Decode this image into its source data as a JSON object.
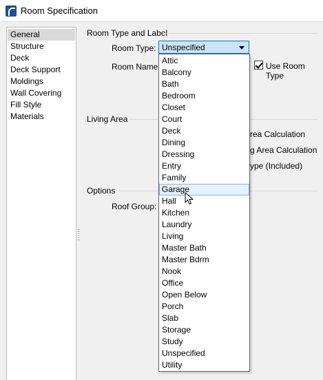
{
  "window": {
    "title": "Room Specification"
  },
  "sidebar": {
    "items": [
      {
        "label": "General",
        "selected": true
      },
      {
        "label": "Structure"
      },
      {
        "label": "Deck"
      },
      {
        "label": "Deck Support"
      },
      {
        "label": "Moldings"
      },
      {
        "label": "Wall Covering"
      },
      {
        "label": "Fill Style"
      },
      {
        "label": "Materials"
      }
    ]
  },
  "room_type_group": {
    "heading": "Room Type and Label",
    "room_type_label": "Room Type:",
    "room_type_value": "Unspecified",
    "room_name_label": "Room Name:",
    "use_room_type_label": "Use Room Type",
    "use_room_type_checked": true
  },
  "living_area_group": {
    "heading": "Living Area",
    "option1_partial": "rea Calculation",
    "option2_partial": "g Area Calculation",
    "option3_partial": "ype (Included)"
  },
  "options_group": {
    "heading": "Options",
    "roof_group_label": "Roof Group:"
  },
  "dropdown": {
    "highlighted": "Garage",
    "options": [
      "Attic",
      "Balcony",
      "Bath",
      "Bedroom",
      "Closet",
      "Court",
      "Deck",
      "Dining",
      "Dressing",
      "Entry",
      "Family",
      "Garage",
      "Hall",
      "Kitchen",
      "Laundry",
      "Living",
      "Master Bath",
      "Master Bdrm",
      "Nook",
      "Office",
      "Open Below",
      "Porch",
      "Slab",
      "Storage",
      "Study",
      "Unspecified",
      "Utility"
    ]
  },
  "colors": {
    "combo_bg": "#cce4f7",
    "combo_border": "#0078d7",
    "highlight_bg": "#e5f1fb",
    "highlight_border": "#7eb4ea"
  }
}
